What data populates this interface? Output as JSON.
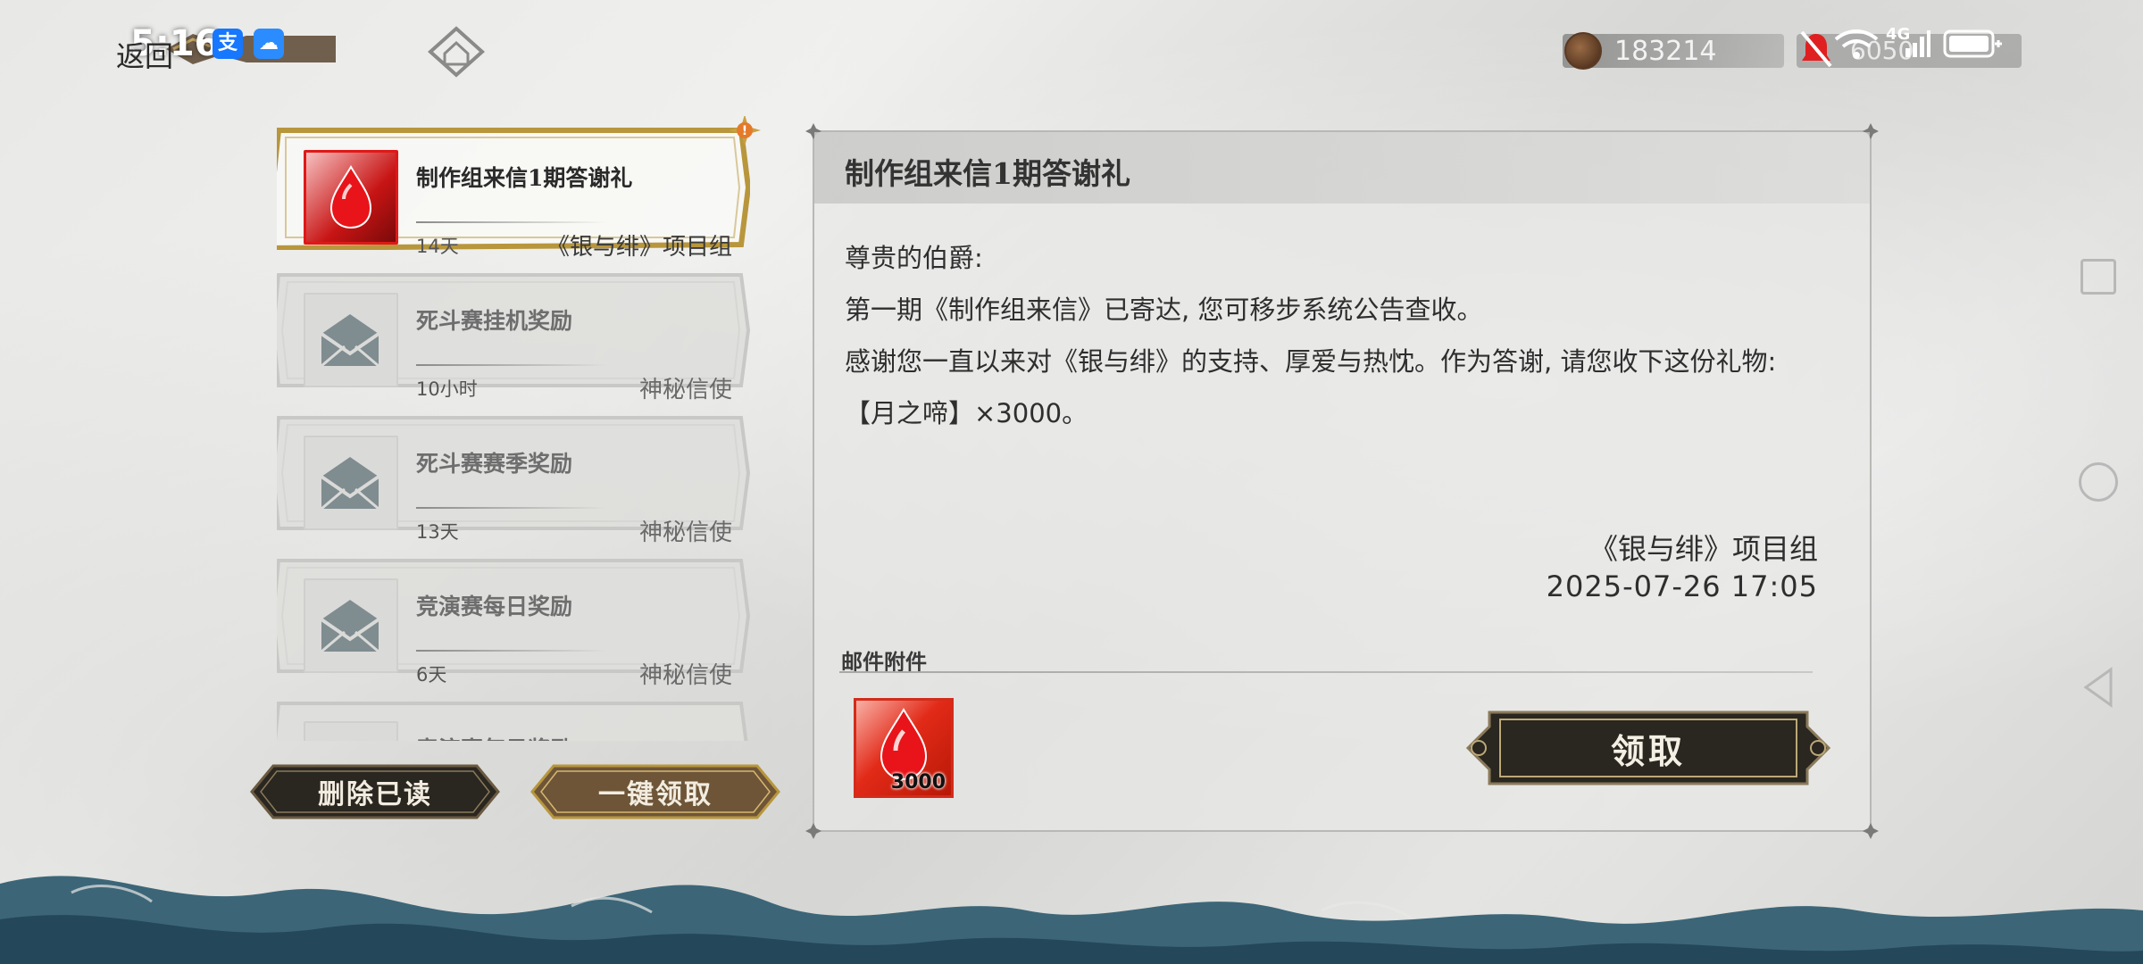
{
  "status_bar": {
    "time": "5:16",
    "alipay_badge": "支",
    "weather_badge": "☁",
    "network_label": "4G",
    "stamina_text": "6050"
  },
  "top_bar": {
    "back_label": "返回",
    "currency_value": "183214"
  },
  "mail_list": {
    "items": [
      {
        "title": "制作组来信1期答谢礼",
        "time": "14天",
        "sender": "《银与绯》项目组",
        "icon": "red-gem-icon",
        "selected": true
      },
      {
        "title": "死斗赛挂机奖励",
        "time": "10小时",
        "sender": "神秘信使",
        "icon": "envelope-icon",
        "selected": false
      },
      {
        "title": "死斗赛赛季奖励",
        "time": "13天",
        "sender": "神秘信使",
        "icon": "envelope-icon",
        "selected": false
      },
      {
        "title": "竞演赛每日奖励",
        "time": "6天",
        "sender": "神秘信使",
        "icon": "envelope-icon",
        "selected": false
      },
      {
        "title": "竞演赛每日奖励",
        "time": "",
        "sender": "",
        "icon": "envelope-icon",
        "selected": false
      }
    ],
    "delete_read_label": "删除已读",
    "claim_all_label": "一键领取"
  },
  "detail": {
    "title": "制作组来信1期答谢礼",
    "greeting": "尊贵的伯爵:",
    "line1": "第一期《制作组来信》已寄达, 您可移步系统公告查收。",
    "line2": "感谢您一直以来对《银与绯》的支持、厚爱与热忱。作为答谢, 请您收下这份礼物:",
    "line3": "【月之啼】×3000。",
    "signature": "《银与绯》项目组",
    "datetime": "2025-07-26  17:05",
    "attachments_label": "邮件附件",
    "attachment": {
      "name": "red-gem-icon",
      "count": "3000"
    },
    "claim_label": "领取"
  },
  "colors": {
    "accent_gold": "#b8963c",
    "button_dark": "#2a2620",
    "gem_red": "#d81a14",
    "wave_blue": "#2f566a"
  }
}
